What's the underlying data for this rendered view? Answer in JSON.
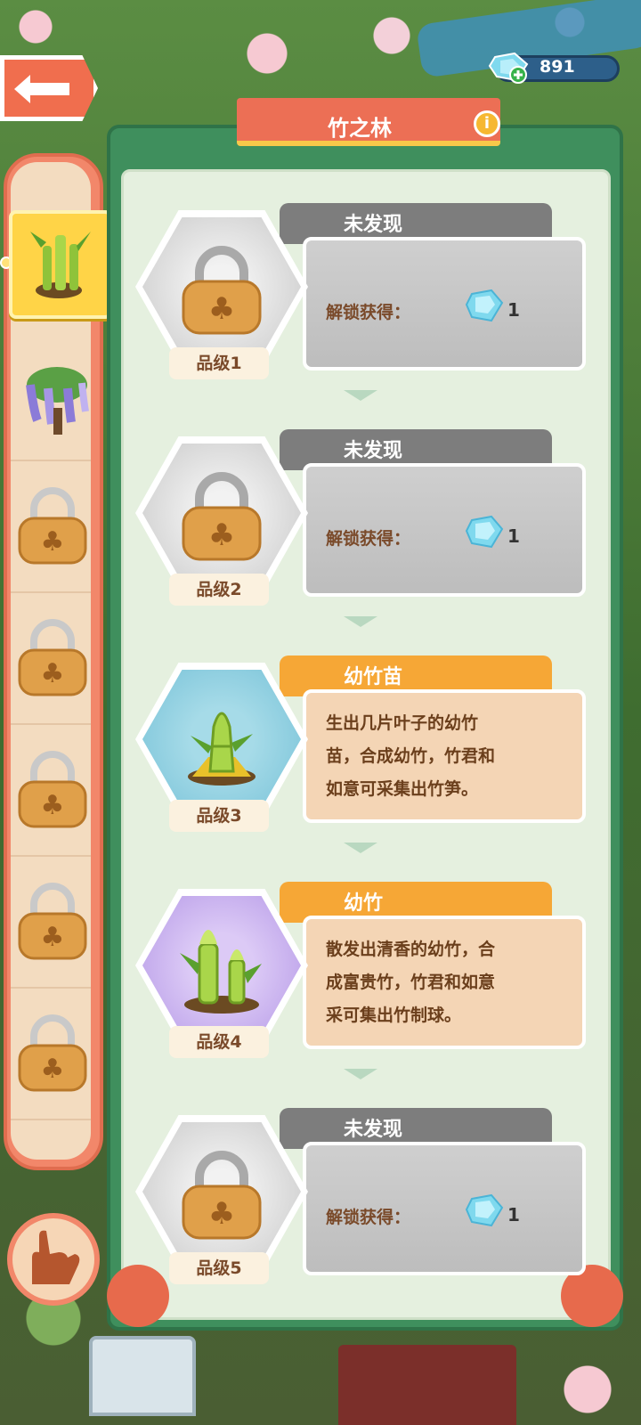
{
  "title": "竹之林",
  "currency": {
    "gems": "891"
  },
  "sidebar": {
    "items": [
      {
        "name": "bamboo",
        "selected": true
      },
      {
        "name": "wisteria",
        "selected": false
      },
      {
        "name": "locked",
        "selected": false
      },
      {
        "name": "locked",
        "selected": false
      },
      {
        "name": "locked",
        "selected": false
      },
      {
        "name": "locked",
        "selected": false
      },
      {
        "name": "locked",
        "selected": false
      }
    ]
  },
  "cards": [
    {
      "status": "未发现",
      "unlock_label": "解锁获得：",
      "reward": "1",
      "grade": "品级1"
    },
    {
      "status": "未发现",
      "unlock_label": "解锁获得：",
      "reward": "1",
      "grade": "品级2"
    },
    {
      "status": "幼竹苗",
      "description": [
        "生出几片叶子的幼竹",
        "苗，合成幼竹，竹君和",
        "如意可采集出竹笋。"
      ],
      "grade": "品级3"
    },
    {
      "status": "幼竹",
      "description": [
        "散发出清香的幼竹，合",
        "成富贵竹，竹君和如意",
        "采可集出竹制球。"
      ],
      "grade": "品级4"
    },
    {
      "status": "未发现",
      "unlock_label": "解锁获得：",
      "reward": "1",
      "grade": "品级5"
    }
  ],
  "colors": {
    "panel": "#3f8f5d",
    "banner": "#ec6f55",
    "locked_tab": "#7d7d7d",
    "found_tab": "#f6a736",
    "sidebar": "#f2876a"
  }
}
